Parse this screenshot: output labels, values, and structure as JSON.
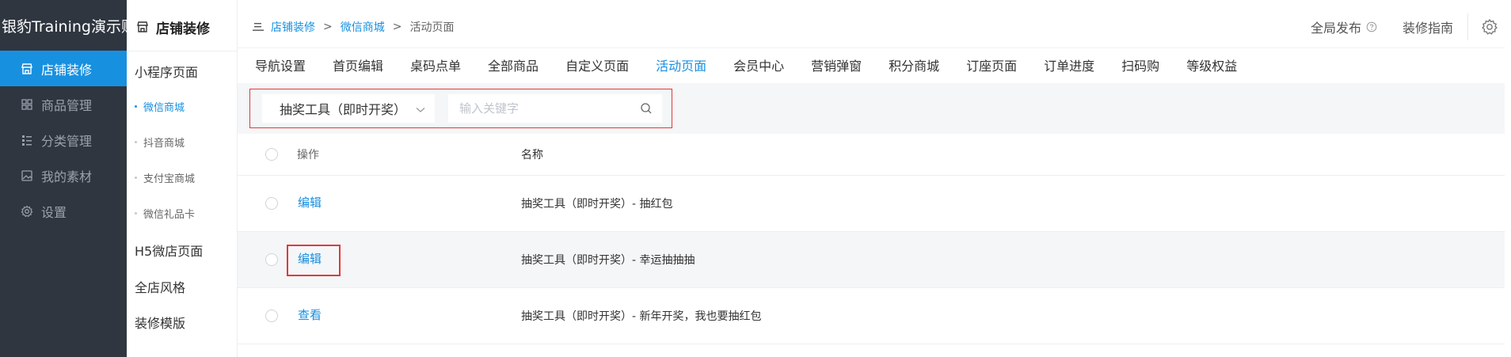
{
  "sidebar": {
    "brand": "银豹Training演示账号",
    "items": [
      {
        "label": "店铺装修",
        "icon": "store-icon",
        "active": true
      },
      {
        "label": "商品管理",
        "icon": "grid-icon",
        "active": false
      },
      {
        "label": "分类管理",
        "icon": "list-icon",
        "active": false
      },
      {
        "label": "我的素材",
        "icon": "image-icon",
        "active": false
      },
      {
        "label": "设置",
        "icon": "gear-icon",
        "active": false
      }
    ]
  },
  "subnav": {
    "title": "店铺装修",
    "group_miniprogram": "小程序页面",
    "items": [
      {
        "label": "微信商城",
        "active": true
      },
      {
        "label": "抖音商城",
        "active": false
      },
      {
        "label": "支付宝商城",
        "active": false
      },
      {
        "label": "微信礼品卡",
        "active": false
      }
    ],
    "group_h5": "H5微店页面",
    "group_style": "全店风格",
    "group_template": "装修模版"
  },
  "breadcrumb": {
    "items": [
      "店铺装修",
      "微信商城",
      "活动页面"
    ],
    "separator": ">"
  },
  "header": {
    "publish": "全局发布",
    "guide": "装修指南"
  },
  "tabs": [
    "导航设置",
    "首页编辑",
    "桌码点单",
    "全部商品",
    "自定义页面",
    "活动页面",
    "会员中心",
    "营销弹窗",
    "积分商城",
    "订座页面",
    "订单进度",
    "扫码购",
    "等级权益"
  ],
  "active_tab": "活动页面",
  "filter": {
    "selected": "抽奖工具（即时开奖）",
    "search_placeholder": "输入关键字"
  },
  "table": {
    "columns": [
      "操作",
      "名称"
    ],
    "rows": [
      {
        "action": "编辑",
        "name": "抽奖工具（即时开奖）- 抽红包"
      },
      {
        "action": "编辑",
        "name": "抽奖工具（即时开奖）- 幸运抽抽抽"
      },
      {
        "action": "查看",
        "name": "抽奖工具（即时开奖）- 新年开奖，我也要抽红包"
      }
    ]
  },
  "colors": {
    "accent": "#1890e0",
    "sidebar_bg": "#2f3640",
    "highlight": "#e03a3a"
  }
}
